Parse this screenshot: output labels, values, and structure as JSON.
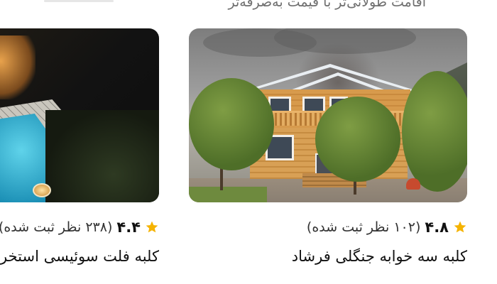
{
  "header": {
    "subtitle": "اقامت طولانی‌تر با قیمت به‌صرفه‌تر"
  },
  "colors": {
    "star": "#F5B301",
    "text_primary": "#111111",
    "text_secondary": "#6F6F6F"
  },
  "listings": [
    {
      "photo_alt": "wooden-cabin-photo",
      "rating": "۴.۸",
      "reviews": "(۱۰۲ نظر ثبت شده)",
      "title": "کلبه سه خوابه جنگلی فرشاد"
    },
    {
      "photo_alt": "night-pool-photo",
      "rating": "۴.۴",
      "reviews": "(۲۳۸ نظر ثبت شده)",
      "title": "کلبه فلت سوئیسی استخردار"
    }
  ]
}
